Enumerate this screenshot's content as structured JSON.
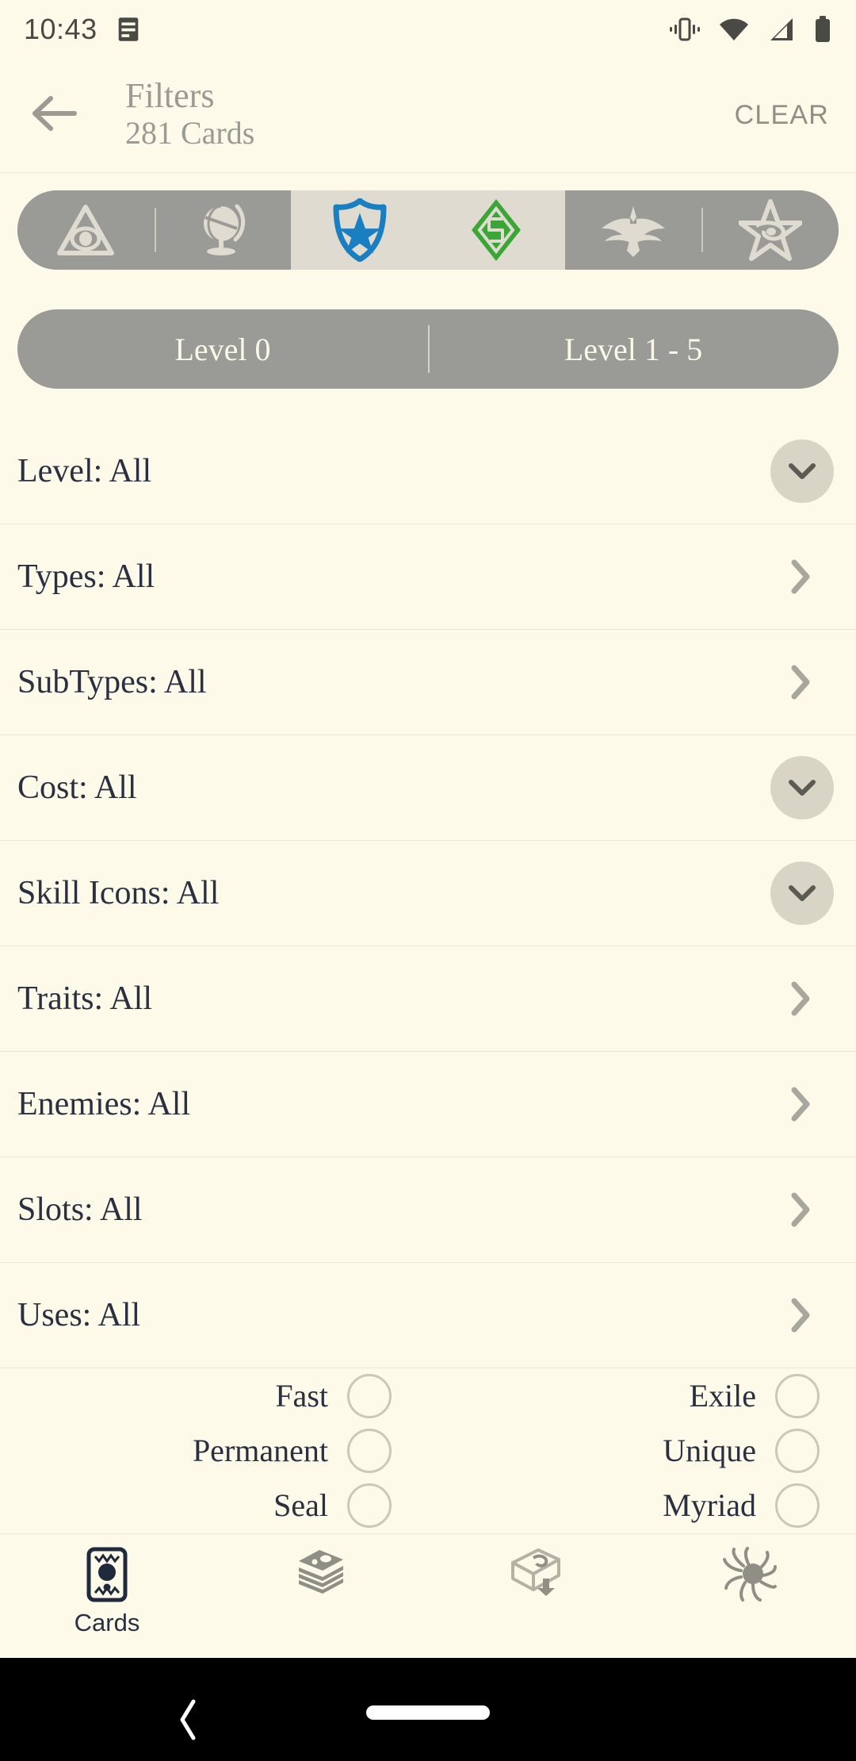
{
  "status_bar": {
    "time": "10:43",
    "left_icons": [
      "notes-notification-icon"
    ],
    "right_icons": [
      "vibrate-icon",
      "wifi-icon",
      "cell-signal-icon",
      "battery-icon"
    ]
  },
  "header": {
    "back_icon": "arrow-left-icon",
    "title": "Filters",
    "subtitle": "281 Cards",
    "clear_label": "CLEAR"
  },
  "faction_filter": {
    "segments": [
      {
        "name": "Mystic",
        "icon": "mystic-eye-triangle-icon",
        "selected": false
      },
      {
        "name": "Seeker",
        "icon": "seeker-globe-icon",
        "selected": false
      },
      {
        "name": "Guardian",
        "icon": "guardian-shield-star-icon",
        "selected": true
      },
      {
        "name": "Rogue",
        "icon": "rogue-diamond-icon",
        "selected": true
      },
      {
        "name": "Survivor",
        "icon": "survivor-bird-icon",
        "selected": false
      },
      {
        "name": "Neutral",
        "icon": "neutral-elder-sign-icon",
        "selected": false
      }
    ],
    "colors": {
      "track": "#9a9a96",
      "selected_bg": "#dfdbd0",
      "guardian": "#1a7fc1",
      "rogue": "#3aa635",
      "inactive_icon": "#dfdbd0"
    }
  },
  "level_filter": {
    "segments": [
      {
        "label": "Level 0",
        "selected": false
      },
      {
        "label": "Level 1 - 5",
        "selected": false
      }
    ]
  },
  "filter_rows": [
    {
      "label": "Level: All",
      "control": "circle-chevron-down"
    },
    {
      "label": "Types: All",
      "control": "chevron-right"
    },
    {
      "label": "SubTypes: All",
      "control": "chevron-right"
    },
    {
      "label": "Cost: All",
      "control": "circle-chevron-down"
    },
    {
      "label": "Skill Icons: All",
      "control": "circle-chevron-down"
    },
    {
      "label": "Traits: All",
      "control": "chevron-right"
    },
    {
      "label": "Enemies: All",
      "control": "chevron-right"
    },
    {
      "label": "Slots: All",
      "control": "chevron-right"
    },
    {
      "label": "Uses: All",
      "control": "chevron-right"
    }
  ],
  "checkboxes": [
    {
      "label": "Fast",
      "checked": false
    },
    {
      "label": "Exile",
      "checked": false
    },
    {
      "label": "Permanent",
      "checked": false
    },
    {
      "label": "Unique",
      "checked": false
    },
    {
      "label": "Seal",
      "checked": false
    },
    {
      "label": "Myriad",
      "checked": false
    }
  ],
  "bottom_nav": [
    {
      "label": "Cards",
      "icon": "card-elder-sign-icon",
      "active": true
    },
    {
      "label": "",
      "icon": "deck-stack-icon",
      "active": false
    },
    {
      "label": "",
      "icon": "deck-import-icon",
      "active": false
    },
    {
      "label": "",
      "icon": "chaos-bag-icon",
      "active": false
    }
  ],
  "android_nav": {
    "back_icon": "system-back-icon",
    "home_icon": "system-home-pill"
  },
  "theme": {
    "background": "#fdfaea",
    "text_primary": "#2b3040",
    "text_muted": "#9b9b93",
    "divider": "#ebe7d7",
    "chip_gray": "#9a9a96"
  }
}
